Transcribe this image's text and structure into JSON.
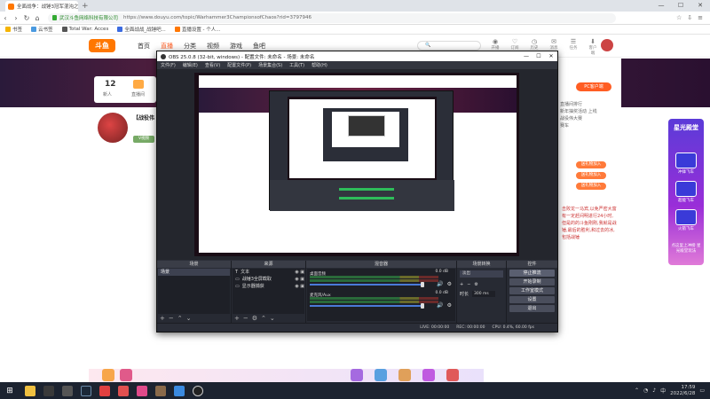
{
  "browser": {
    "tab_title": "全面战争：战锤3冠军混沌之",
    "nav": {
      "back": "‹",
      "forward": "›",
      "reload": "↻",
      "home": "⌂"
    },
    "site_name": "武汉斗鱼网络科技有限公司",
    "url": "https://www.douyu.com/topic/Warhammer3ChampionsofChaos?rid=3797946",
    "bookmarks": [
      "书签",
      "云书签",
      "Total War: Acces",
      "全面战战_战锤吧...",
      "直播设置 - 个人..."
    ],
    "window_controls": [
      "—",
      "☐",
      "✕"
    ]
  },
  "douyu": {
    "logo_text": "斗鱼",
    "nav_items": [
      "首页",
      "直播",
      "分类",
      "视频",
      "游戏",
      "鱼吧"
    ],
    "active_nav": "直播",
    "header_icons": [
      "开播",
      "订阅",
      "历史",
      "消息",
      "任务",
      "客户端"
    ],
    "stat_card": {
      "number": "12",
      "label": "新人",
      "label2": "直播间"
    },
    "streamer_title": "【战役伟",
    "streamer_tag": "V视频",
    "pc_button": "PC客户端",
    "right_lines": [
      "直播间排行",
      "新年抽奖活动 上线",
      "战役伟大赛",
      "赛车"
    ],
    "pills": [
      "送礼物加入",
      "送礼物加入",
      "送礼物加入"
    ],
    "chat_text": "击败龙一马宾,以免严密大富有一定赶间明进行24小时,但是的的斗鱼刚刚,我就是战锤,最后的胜利,和过去的冰,包括战锤"
  },
  "promo": {
    "title": "星光殿堂",
    "items": [
      "冲锋飞车",
      "超能飞车",
      "火箭飞车"
    ],
    "footer": "点这里上冲榜 星光殿堂玩法"
  },
  "obs": {
    "title": "OBS 25.0.8 (32-bit, windows) - 配置文件: 未命名 - 场景: 未命名",
    "menu": [
      "文件(F)",
      "编辑(E)",
      "查看(V)",
      "配置文件(P)",
      "场景集合(S)",
      "工具(T)",
      "帮助(H)"
    ],
    "dock_titles": {
      "scenes": "场景",
      "sources": "来源",
      "mixer": "混音器",
      "transitions": "场景转换",
      "controls": "控件"
    },
    "scenes": [
      "场景"
    ],
    "sources": [
      "文本",
      "战锤3全屏截取",
      "显示器捕获"
    ],
    "mixer": [
      {
        "name": "桌面音频",
        "db": "0.0 dB"
      },
      {
        "name": "麦克风/Aux",
        "db": "0.0 dB"
      }
    ],
    "transition": {
      "type": "淡出",
      "duration_label": "时长",
      "duration_value": "300 ms"
    },
    "controls": [
      "停止推流",
      "开始录制",
      "工作室模式",
      "设置",
      "退出"
    ],
    "status": {
      "live": "LIVE: 00:00:00",
      "rec": "REC: 00:00:00",
      "cpu": "CPU: 0.4%, 60.00 fps"
    }
  },
  "taskbar": {
    "time": "17:59",
    "date": "2022/6/28"
  }
}
